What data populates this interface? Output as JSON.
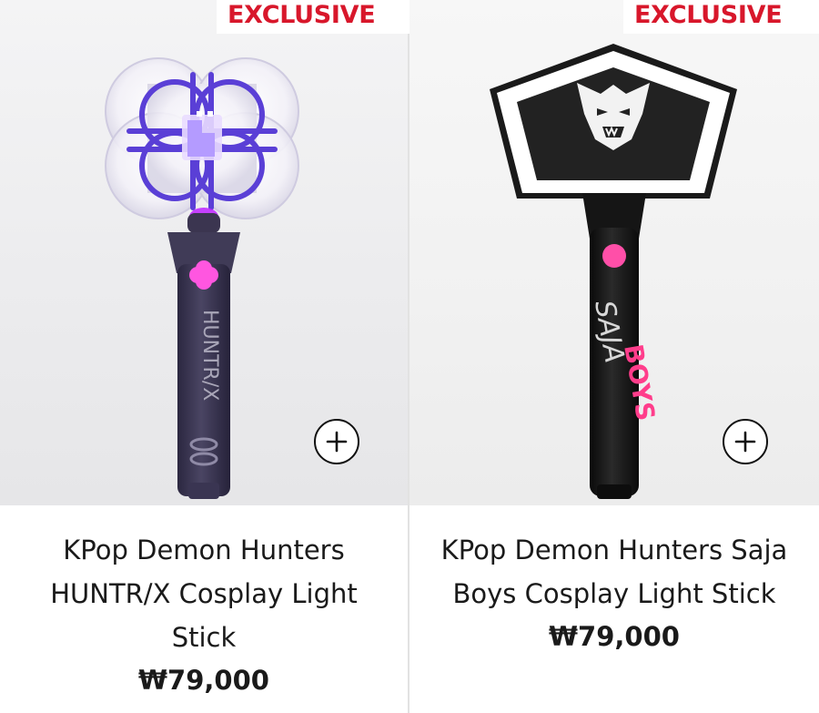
{
  "products": [
    {
      "badge": "EXCLUSIVE",
      "title": "KPop Demon Hunters HUNTR/X Cosplay Light Stick",
      "price": "₩79,000",
      "handle_text": "HUNTR/X",
      "add_icon": "plus-circle-icon",
      "colors": {
        "glow": "#7b3cf0",
        "button": "#ff4fd8",
        "handle": "#3a3552"
      }
    },
    {
      "badge": "EXCLUSIVE",
      "title": "KPop Demon Hunters Saja Boys Cosplay Light Stick",
      "price": "₩79,000",
      "handle_text_1": "SAJA",
      "handle_text_2": "BOYS",
      "add_icon": "plus-circle-icon",
      "colors": {
        "button": "#ff4fa8",
        "handle": "#121212",
        "logo_pink": "#ff3d8b"
      }
    }
  ],
  "colors": {
    "badge_text": "#d8172b",
    "text": "#1a1a1a"
  }
}
